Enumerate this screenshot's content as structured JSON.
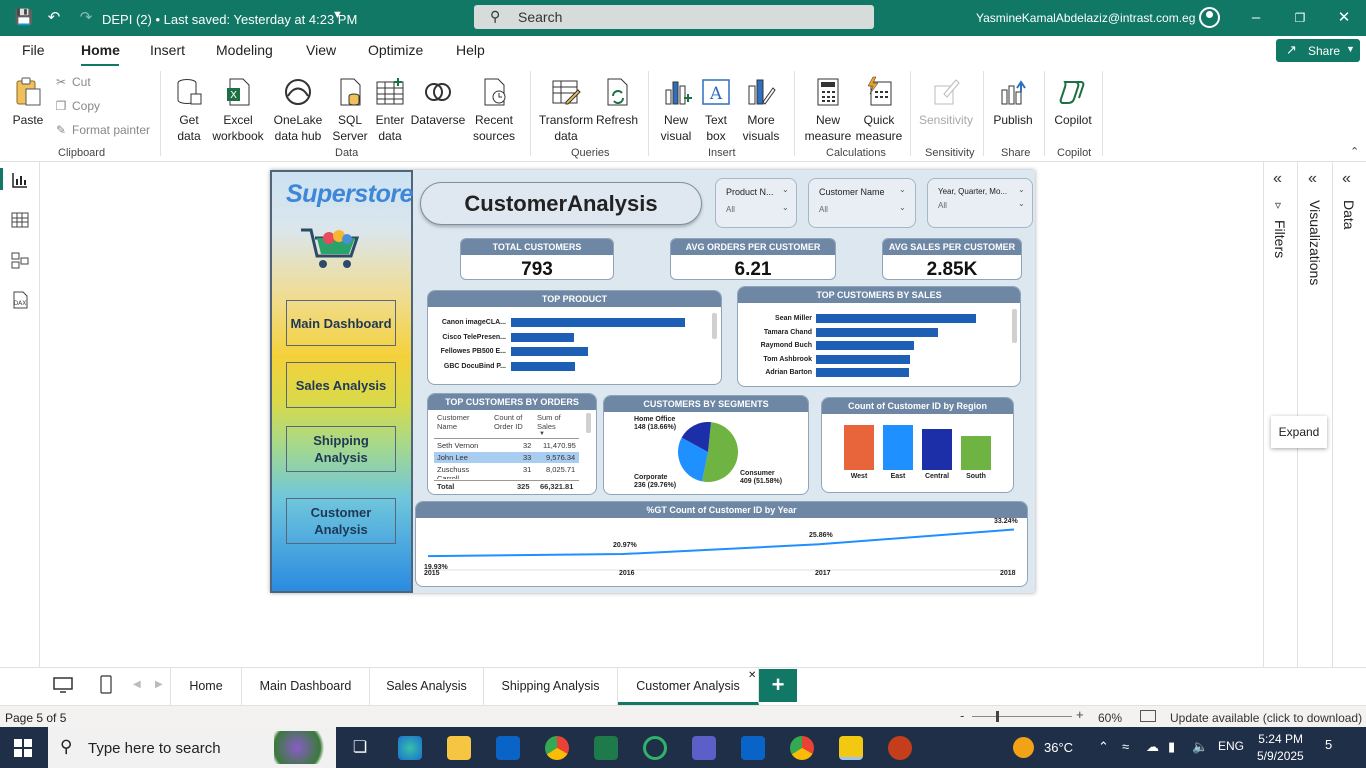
{
  "titlebar": {
    "doc_title": "DEPI (2) • Last saved: Yesterday at 4:23 PM",
    "search_placeholder": "Search",
    "user_email": "YasmineKamalAbdelaziz@intrast.com.eg"
  },
  "menu": {
    "items": [
      "File",
      "Home",
      "Insert",
      "Modeling",
      "View",
      "Optimize",
      "Help"
    ],
    "active": "Home",
    "share_label": "Share"
  },
  "ribbon": {
    "clipboard": {
      "paste": "Paste",
      "cut": "Cut",
      "copy": "Copy",
      "format_painter": "Format painter",
      "label": "Clipboard"
    },
    "data": {
      "get_data": "Get data",
      "excel": "Excel workbook",
      "onelake": "OneLake data hub",
      "sql": "SQL Server",
      "enter": "Enter data",
      "dataverse": "Dataverse",
      "recent": "Recent sources",
      "label": "Data"
    },
    "queries": {
      "transform": "Transform data",
      "refresh": "Refresh",
      "label": "Queries"
    },
    "insert": {
      "new_visual": "New visual",
      "text_box": "Text box",
      "more_visuals": "More visuals",
      "label": "Insert"
    },
    "calculations": {
      "new_measure": "New measure",
      "quick_measure": "Quick measure",
      "label": "Calculations"
    },
    "sensitivity": {
      "sensitivity": "Sensitivity",
      "label": "Sensitivity"
    },
    "share": {
      "publish": "Publish",
      "label": "Share"
    },
    "copilot": {
      "copilot": "Copilot",
      "label": "Copilot"
    }
  },
  "report": {
    "logo": "Superstore",
    "title": "CustomerAnalysis",
    "nav_buttons": [
      "Main Dashboard",
      "Sales Analysis",
      "Shipping Analysis",
      "Customer Analysis"
    ],
    "slicers": [
      {
        "label": "Product N...",
        "value": "All"
      },
      {
        "label": "Customer Name",
        "value": "All"
      },
      {
        "label": "Year, Quarter, Mo...",
        "value": "All"
      }
    ],
    "kpis": [
      {
        "label": "TOTAL CUSTOMERS",
        "value": "793"
      },
      {
        "label": "AVG ORDERS PER CUSTOMER",
        "value": "6.21"
      },
      {
        "label": "AVG SALES PER CUSTOMER",
        "value": "2.85K"
      }
    ],
    "top_product": {
      "title": "TOP PRODUCT",
      "items": [
        "Canon imageCLA...",
        "Cisco TelePresen...",
        "Fellowes PB500 E...",
        "GBC DocuBind P..."
      ],
      "values": [
        1.0,
        0.36,
        0.44,
        0.37
      ]
    },
    "top_customers_sales": {
      "title": "TOP CUSTOMERS BY SALES",
      "items": [
        "Sean Miller",
        "Tamara Chand",
        "Raymond Buch",
        "Tom Ashbrook",
        "Adrian Barton"
      ],
      "values": [
        1.0,
        0.76,
        0.61,
        0.59,
        0.58
      ]
    },
    "top_customers_orders": {
      "title": "TOP CUSTOMERS BY ORDERS",
      "headers": [
        "Customer Name",
        "Count of Order ID",
        "Sum of Sales"
      ],
      "rows": [
        [
          "Seth Vernon",
          "32",
          "11,470.95"
        ],
        [
          "John Lee",
          "33",
          "9,576.34"
        ],
        [
          "Zuschuss Carroll",
          "31",
          "8,025.71"
        ]
      ],
      "total": [
        "Total",
        "325",
        "66,321.81"
      ]
    },
    "segments": {
      "title": "CUSTOMERS BY SEGMENTS",
      "home_office": "Home Office\n148 (18.66%)",
      "corporate": "Corporate\n236 (29.76%)",
      "consumer": "Consumer\n409 (51.58%)"
    },
    "region": {
      "title": "Count of Customer ID by Region",
      "categories": [
        "West",
        "East",
        "Central",
        "South"
      ],
      "values": [
        0.93,
        0.93,
        0.86,
        0.7
      ],
      "colors": [
        "#e8643a",
        "#1e90ff",
        "#1c2fa8",
        "#6fb343"
      ]
    },
    "trend": {
      "title": "%GT Count of Customer ID by Year",
      "years": [
        "2015",
        "2016",
        "2017",
        "2018"
      ],
      "values": [
        "19.93%",
        "20.97%",
        "25.86%",
        "33.24%"
      ]
    }
  },
  "right_panes": {
    "filters": "Filters",
    "visualizations": "Visualizations",
    "data": "Data",
    "expand_tip": "Expand"
  },
  "tabs": [
    "Home",
    "Main Dashboard",
    "Sales Analysis",
    "Shipping Analysis",
    "Customer Analysis"
  ],
  "status": {
    "page": "Page 5 of 5",
    "zoom": "60%",
    "update": "Update available (click to download)"
  },
  "taskbar": {
    "search": "Type here to search",
    "temp": "36°C",
    "lang": "ENG",
    "time": "5:24 PM",
    "date": "5/9/2025",
    "notif": "5"
  },
  "chart_data": [
    {
      "type": "bar",
      "title": "TOP PRODUCT",
      "categories": [
        "Canon imageCLA...",
        "Cisco TelePresen...",
        "Fellowes PB500 E...",
        "GBC DocuBind P..."
      ],
      "values": [
        1.0,
        0.36,
        0.44,
        0.37
      ]
    },
    {
      "type": "bar",
      "title": "TOP CUSTOMERS BY SALES",
      "categories": [
        "Sean Miller",
        "Tamara Chand",
        "Raymond Buch",
        "Tom Ashbrook",
        "Adrian Barton"
      ],
      "values": [
        1.0,
        0.76,
        0.61,
        0.59,
        0.58
      ]
    },
    {
      "type": "pie",
      "title": "CUSTOMERS BY SEGMENTS",
      "categories": [
        "Consumer",
        "Corporate",
        "Home Office"
      ],
      "values": [
        409,
        236,
        148
      ]
    },
    {
      "type": "bar",
      "title": "Count of Customer ID by Region",
      "categories": [
        "West",
        "East",
        "Central",
        "South"
      ],
      "values": [
        0.93,
        0.93,
        0.86,
        0.7
      ]
    },
    {
      "type": "line",
      "title": "%GT Count of Customer ID by Year",
      "x": [
        "2015",
        "2016",
        "2017",
        "2018"
      ],
      "values": [
        19.93,
        20.97,
        25.86,
        33.24
      ]
    }
  ]
}
